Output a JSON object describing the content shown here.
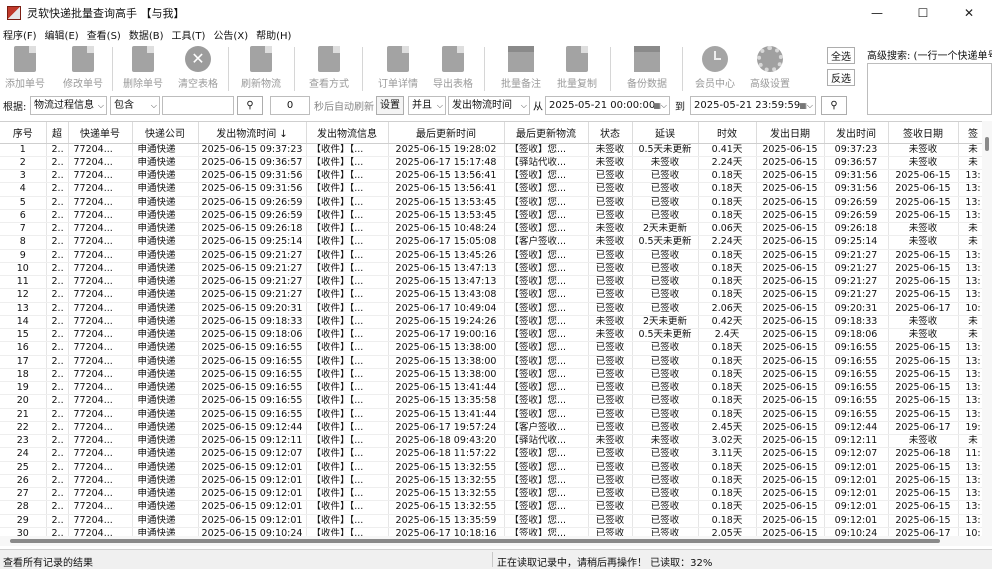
{
  "window": {
    "title": "灵软快递批量查询高手 【与我】",
    "minimize": "—",
    "maximize": "☐",
    "close": "✕"
  },
  "menu": [
    "程序(F)",
    "编辑(E)",
    "查看(S)",
    "数据(B)",
    "工具(T)",
    "公告(X)",
    "帮助(H)"
  ],
  "toolbar": {
    "add": "添加单号",
    "edit": "修改单号",
    "delete": "删除单号",
    "clear": "清空表格",
    "refresh": "刷新物流",
    "view_mode": "查看方式",
    "order_detail": "订单详情",
    "export": "导出表格",
    "batch_note": "批量备注",
    "batch_copy": "批量复制",
    "backup": "备份数据",
    "member": "会员中心",
    "settings": "高级设置",
    "select_all": "全选",
    "invert": "反选"
  },
  "advanced_search": {
    "label": "高级搜索: (一行一个快递单号)"
  },
  "filter": {
    "by_label": "根据:",
    "field": "物流过程信息",
    "op": "包含",
    "value": "",
    "seconds": "0",
    "auto_refresh": "秒后自动刷新",
    "set": "设置",
    "and": "并且",
    "time_field": "发出物流时间",
    "from_label": "从",
    "from": "2025-05-21 00:00:00",
    "to_label": "到",
    "to": "2025-05-21 23:59:59"
  },
  "table": {
    "columns": [
      "序号",
      "超",
      "快递单号",
      "快递公司",
      "发出物流时间 ↓",
      "发出物流信息",
      "最后更新时间",
      "最后更新物流",
      "状态",
      "延误",
      "时效",
      "发出日期",
      "发出时间",
      "签收日期",
      "签"
    ],
    "rows": [
      [
        "1",
        "2..",
        "77204...",
        "申通快递",
        "2025-06-15 09:37:23",
        "【收件】【...",
        "2025-06-15 19:28:02",
        "【签收】您...",
        "未签收",
        "0.5天未更新",
        "0.41天",
        "2025-06-15",
        "09:37:23",
        "未签收",
        "未"
      ],
      [
        "2",
        "2..",
        "77204...",
        "申通快递",
        "2025-06-15 09:36:57",
        "【收件】【...",
        "2025-06-17 15:17:48",
        "【驿站代收...",
        "未签收",
        "未签收",
        "2.24天",
        "2025-06-15",
        "09:36:57",
        "未签收",
        "未"
      ],
      [
        "3",
        "2..",
        "77204...",
        "申通快递",
        "2025-06-15 09:31:56",
        "【收件】【...",
        "2025-06-15 13:56:41",
        "【签收】您...",
        "已签收",
        "已签收",
        "0.18天",
        "2025-06-15",
        "09:31:56",
        "2025-06-15",
        "13:"
      ],
      [
        "4",
        "2..",
        "77204...",
        "申通快递",
        "2025-06-15 09:31:56",
        "【收件】【...",
        "2025-06-15 13:56:41",
        "【签收】您...",
        "已签收",
        "已签收",
        "0.18天",
        "2025-06-15",
        "09:31:56",
        "2025-06-15",
        "13:"
      ],
      [
        "5",
        "2..",
        "77204...",
        "申通快递",
        "2025-06-15 09:26:59",
        "【收件】【...",
        "2025-06-15 13:53:45",
        "【签收】您...",
        "已签收",
        "已签收",
        "0.18天",
        "2025-06-15",
        "09:26:59",
        "2025-06-15",
        "13:"
      ],
      [
        "6",
        "2..",
        "77204...",
        "申通快递",
        "2025-06-15 09:26:59",
        "【收件】【...",
        "2025-06-15 13:53:45",
        "【签收】您...",
        "已签收",
        "已签收",
        "0.18天",
        "2025-06-15",
        "09:26:59",
        "2025-06-15",
        "13:"
      ],
      [
        "7",
        "2..",
        "77204...",
        "申通快递",
        "2025-06-15 09:26:18",
        "【收件】【...",
        "2025-06-15 10:48:24",
        "【签收】您...",
        "未签收",
        "2天未更新",
        "0.06天",
        "2025-06-15",
        "09:26:18",
        "未签收",
        "未"
      ],
      [
        "8",
        "2..",
        "77204...",
        "申通快递",
        "2025-06-15 09:25:14",
        "【收件】【...",
        "2025-06-17 15:05:08",
        "【客户签收...",
        "未签收",
        "0.5天未更新",
        "2.24天",
        "2025-06-15",
        "09:25:14",
        "未签收",
        "未"
      ],
      [
        "9",
        "2..",
        "77204...",
        "申通快递",
        "2025-06-15 09:21:27",
        "【收件】【...",
        "2025-06-15 13:45:26",
        "【签收】您...",
        "已签收",
        "已签收",
        "0.18天",
        "2025-06-15",
        "09:21:27",
        "2025-06-15",
        "13:"
      ],
      [
        "10",
        "2..",
        "77204...",
        "申通快递",
        "2025-06-15 09:21:27",
        "【收件】【...",
        "2025-06-15 13:47:13",
        "【签收】您...",
        "已签收",
        "已签收",
        "0.18天",
        "2025-06-15",
        "09:21:27",
        "2025-06-15",
        "13:"
      ],
      [
        "11",
        "2..",
        "77204...",
        "申通快递",
        "2025-06-15 09:21:27",
        "【收件】【...",
        "2025-06-15 13:47:13",
        "【签收】您...",
        "已签收",
        "已签收",
        "0.18天",
        "2025-06-15",
        "09:21:27",
        "2025-06-15",
        "13:"
      ],
      [
        "12",
        "2..",
        "77204...",
        "申通快递",
        "2025-06-15 09:21:27",
        "【收件】【...",
        "2025-06-15 13:43:08",
        "【签收】您...",
        "已签收",
        "已签收",
        "0.18天",
        "2025-06-15",
        "09:21:27",
        "2025-06-15",
        "13:"
      ],
      [
        "13",
        "2..",
        "77204...",
        "申通快递",
        "2025-06-15 09:20:31",
        "【收件】【...",
        "2025-06-17 10:49:04",
        "【签收】您...",
        "已签收",
        "已签收",
        "2.06天",
        "2025-06-15",
        "09:20:31",
        "2025-06-17",
        "10:"
      ],
      [
        "14",
        "2..",
        "77204...",
        "申通快递",
        "2025-06-15 09:18:33",
        "【收件】【...",
        "2025-06-15 19:24:26",
        "【签收】您...",
        "未签收",
        "2天未更新",
        "0.42天",
        "2025-06-15",
        "09:18:33",
        "未签收",
        "未"
      ],
      [
        "15",
        "2..",
        "77204...",
        "申通快递",
        "2025-06-15 09:18:06",
        "【收件】【...",
        "2025-06-17 19:00:16",
        "【签收】您...",
        "未签收",
        "0.5天未更新",
        "2.4天",
        "2025-06-15",
        "09:18:06",
        "未签收",
        "未"
      ],
      [
        "16",
        "2..",
        "77204...",
        "申通快递",
        "2025-06-15 09:16:55",
        "【收件】【...",
        "2025-06-15 13:38:00",
        "【签收】您...",
        "已签收",
        "已签收",
        "0.18天",
        "2025-06-15",
        "09:16:55",
        "2025-06-15",
        "13:"
      ],
      [
        "17",
        "2..",
        "77204...",
        "申通快递",
        "2025-06-15 09:16:55",
        "【收件】【...",
        "2025-06-15 13:38:00",
        "【签收】您...",
        "已签收",
        "已签收",
        "0.18天",
        "2025-06-15",
        "09:16:55",
        "2025-06-15",
        "13:"
      ],
      [
        "18",
        "2..",
        "77204...",
        "申通快递",
        "2025-06-15 09:16:55",
        "【收件】【...",
        "2025-06-15 13:38:00",
        "【签收】您...",
        "已签收",
        "已签收",
        "0.18天",
        "2025-06-15",
        "09:16:55",
        "2025-06-15",
        "13:"
      ],
      [
        "19",
        "2..",
        "77204...",
        "申通快递",
        "2025-06-15 09:16:55",
        "【收件】【...",
        "2025-06-15 13:41:44",
        "【签收】您...",
        "已签收",
        "已签收",
        "0.18天",
        "2025-06-15",
        "09:16:55",
        "2025-06-15",
        "13:"
      ],
      [
        "20",
        "2..",
        "77204...",
        "申通快递",
        "2025-06-15 09:16:55",
        "【收件】【...",
        "2025-06-15 13:35:58",
        "【签收】您...",
        "已签收",
        "已签收",
        "0.18天",
        "2025-06-15",
        "09:16:55",
        "2025-06-15",
        "13:"
      ],
      [
        "21",
        "2..",
        "77204...",
        "申通快递",
        "2025-06-15 09:16:55",
        "【收件】【...",
        "2025-06-15 13:41:44",
        "【签收】您...",
        "已签收",
        "已签收",
        "0.18天",
        "2025-06-15",
        "09:16:55",
        "2025-06-15",
        "13:"
      ],
      [
        "22",
        "2..",
        "77204...",
        "申通快递",
        "2025-06-15 09:12:44",
        "【收件】【...",
        "2025-06-17 19:57:24",
        "【客户签收...",
        "已签收",
        "已签收",
        "2.45天",
        "2025-06-15",
        "09:12:44",
        "2025-06-17",
        "19:"
      ],
      [
        "23",
        "2..",
        "77204...",
        "申通快递",
        "2025-06-15 09:12:11",
        "【收件】【...",
        "2025-06-18 09:43:20",
        "【驿站代收...",
        "未签收",
        "未签收",
        "3.02天",
        "2025-06-15",
        "09:12:11",
        "未签收",
        "未"
      ],
      [
        "24",
        "2..",
        "77204...",
        "申通快递",
        "2025-06-15 09:12:07",
        "【收件】【...",
        "2025-06-18 11:57:22",
        "【签收】您...",
        "已签收",
        "已签收",
        "3.11天",
        "2025-06-15",
        "09:12:07",
        "2025-06-18",
        "11:"
      ],
      [
        "25",
        "2..",
        "77204...",
        "申通快递",
        "2025-06-15 09:12:01",
        "【收件】【...",
        "2025-06-15 13:32:55",
        "【签收】您...",
        "已签收",
        "已签收",
        "0.18天",
        "2025-06-15",
        "09:12:01",
        "2025-06-15",
        "13:"
      ],
      [
        "26",
        "2..",
        "77204...",
        "申通快递",
        "2025-06-15 09:12:01",
        "【收件】【...",
        "2025-06-15 13:32:55",
        "【签收】您...",
        "已签收",
        "已签收",
        "0.18天",
        "2025-06-15",
        "09:12:01",
        "2025-06-15",
        "13:"
      ],
      [
        "27",
        "2..",
        "77204...",
        "申通快递",
        "2025-06-15 09:12:01",
        "【收件】【...",
        "2025-06-15 13:32:55",
        "【签收】您...",
        "已签收",
        "已签收",
        "0.18天",
        "2025-06-15",
        "09:12:01",
        "2025-06-15",
        "13:"
      ],
      [
        "28",
        "2..",
        "77204...",
        "申通快递",
        "2025-06-15 09:12:01",
        "【收件】【...",
        "2025-06-15 13:32:55",
        "【签收】您...",
        "已签收",
        "已签收",
        "0.18天",
        "2025-06-15",
        "09:12:01",
        "2025-06-15",
        "13:"
      ],
      [
        "29",
        "2..",
        "77204...",
        "申通快递",
        "2025-06-15 09:12:01",
        "【收件】【...",
        "2025-06-15 13:35:59",
        "【签收】您...",
        "已签收",
        "已签收",
        "0.18天",
        "2025-06-15",
        "09:12:01",
        "2025-06-15",
        "13:"
      ],
      [
        "30",
        "2..",
        "77204...",
        "申通快递",
        "2025-06-15 09:10:24",
        "【收件】【...",
        "2025-06-17 10:18:16",
        "【签收】您...",
        "已签收",
        "已签收",
        "2.05天",
        "2025-06-15",
        "09:10:24",
        "2025-06-17",
        "10:"
      ]
    ]
  },
  "status": {
    "left": "查看所有记录的结果",
    "right": "正在读取记录中，请稍后再操作！ 已读取：32%"
  }
}
